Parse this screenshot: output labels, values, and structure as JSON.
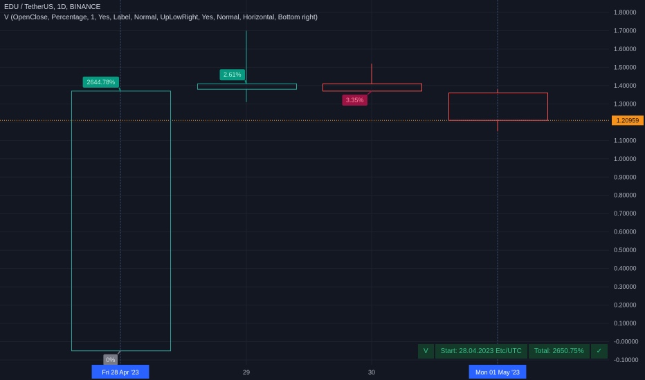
{
  "header": {
    "symbol_line": "EDU / TetherUS, 1D, BINANCE",
    "indicator_line": "V (OpenClose, Percentage, 1, Yes, Label, Normal, UpLowRight, Yes, Normal, Horizontal, Bottom right)"
  },
  "colors": {
    "background": "#131722",
    "up": "#26a69a",
    "down": "#ef5350",
    "grid": "#1e222d",
    "label_up": "#089981",
    "label_down": "#9c1444",
    "label_neutral": "#787b86",
    "price_line": "#f7931a",
    "date_highlight": "#2962ff"
  },
  "chart_data": {
    "type": "candlestick",
    "x": [
      "Fri 28 Apr '23",
      "29",
      "30",
      "Mon 01 May '23"
    ],
    "candles": [
      {
        "date": "Fri 28 Apr '23",
        "open": -0.05,
        "high": 1.37,
        "low": -0.05,
        "close": 1.37
      },
      {
        "date": "29",
        "open": 1.38,
        "high": 1.7,
        "low": 1.31,
        "close": 1.41
      },
      {
        "date": "30",
        "open": 1.41,
        "high": 1.52,
        "low": 1.37,
        "close": 1.37
      },
      {
        "date": "Mon 01 May '23",
        "open": 1.36,
        "high": 1.38,
        "low": 1.15,
        "close": 1.21
      }
    ],
    "ylim": [
      -0.1,
      1.8
    ],
    "y_ticks": [
      1.8,
      1.7,
      1.6,
      1.5,
      1.4,
      1.3,
      1.2,
      1.1,
      1.0,
      0.9,
      0.8,
      0.7,
      0.6,
      0.5,
      0.4,
      0.3,
      0.2,
      0.1,
      0.0,
      -0.1
    ],
    "y_tick_labels": [
      "1.80000",
      "1.70000",
      "1.60000",
      "1.50000",
      "1.40000",
      "1.30000",
      "1.20000",
      "1.10000",
      "1.00000",
      "0.90000",
      "0.80000",
      "0.70000",
      "0.60000",
      "0.50000",
      "0.40000",
      "0.30000",
      "0.20000",
      "0.10000",
      "-0.00000",
      "-0.10000"
    ],
    "current_price": 1.20959,
    "current_price_label": "1.20959",
    "labels": [
      {
        "candle": 0,
        "text": "2644.78%",
        "anchor": 1.37,
        "dir": "up"
      },
      {
        "candle": 0,
        "text": "0%",
        "anchor": -0.05,
        "dir": "neutral"
      },
      {
        "candle": 1,
        "text": "2.61%",
        "anchor": 1.41,
        "dir": "up"
      },
      {
        "candle": 2,
        "text": "3.35%",
        "anchor": 1.37,
        "dir": "down"
      }
    ],
    "vertical_markers": [
      "Fri 28 Apr '23",
      "Mon 01 May '23"
    ]
  },
  "summary": {
    "prefix": "V",
    "start": "Start: 28.04.2023 Etc/UTC",
    "total": "Total: 2650.75%",
    "check": "✓"
  }
}
